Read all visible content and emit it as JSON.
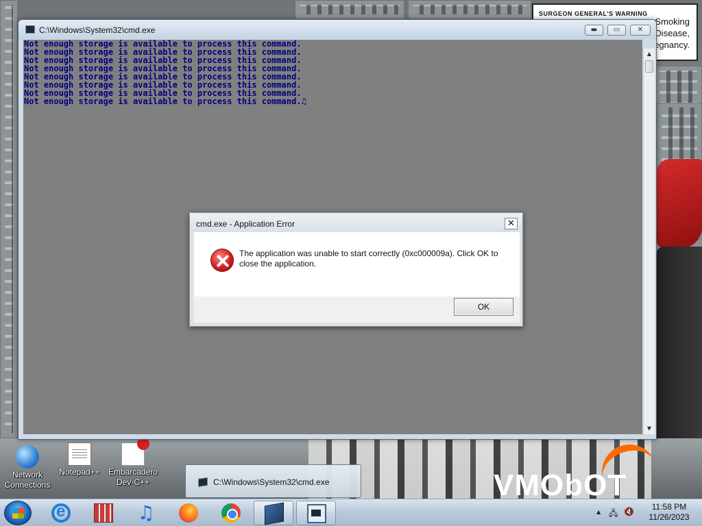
{
  "wallpaper": {
    "warning_sign": {
      "title": "SURGEON GENERAL'S WARNING",
      "lines": [
        "Smoking",
        "Disease,",
        "regnancy."
      ]
    },
    "brand_text": "VMObOT"
  },
  "desktop_icons": [
    {
      "label_line1": "Network",
      "label_line2": "Connections",
      "icon": "network-globe-icon"
    },
    {
      "label_line1": "Notepad++",
      "label_line2": "",
      "icon": "notepad-plus-plus-icon"
    },
    {
      "label_line1": "Embarcadero",
      "label_line2": "Dev-C++",
      "icon": "dev-cpp-icon"
    }
  ],
  "cmd_window": {
    "title": "C:\\Windows\\System32\\cmd.exe",
    "controls": {
      "minimize": "▬",
      "maximize": "▭",
      "close": "✕"
    },
    "lines": [
      "Not enough storage is available to process this command.",
      "Not enough storage is available to process this command.",
      "Not enough storage is available to process this command.",
      "Not enough storage is available to process this command.",
      "Not enough storage is available to process this command.",
      "Not enough storage is available to process this command.",
      "Not enough storage is available to process this command.",
      "Not enough storage is available to process this command."
    ],
    "caret": "♫",
    "background_color": "#808080",
    "text_color": "#000080"
  },
  "error_dialog": {
    "title": "cmd.exe - Application Error",
    "close_label": "✕",
    "message": "The application was unable to start correctly (0xc000009a). Click OK to close the application.",
    "ok_label": "OK",
    "icon": "error-x-icon"
  },
  "taskbar_thumbnail": {
    "label": "C:\\Windows\\System32\\cmd.exe"
  },
  "taskbar": {
    "pinned": [
      {
        "name": "internet-explorer",
        "icon": "internet-explorer-icon"
      },
      {
        "name": "archive-tool",
        "icon": "archive-box-icon"
      },
      {
        "name": "music-player",
        "icon": "music-note-icon"
      },
      {
        "name": "firefox",
        "icon": "firefox-icon"
      },
      {
        "name": "chrome",
        "icon": "chrome-icon"
      },
      {
        "name": "cmd",
        "icon": "cmd-icon"
      },
      {
        "name": "wizard-app",
        "icon": "app-window-icon"
      }
    ],
    "tray": {
      "expand": "▲",
      "network": "🖧",
      "volume": "🔇"
    },
    "clock": {
      "time": "11:58 PM",
      "date": "11/26/2023"
    }
  }
}
